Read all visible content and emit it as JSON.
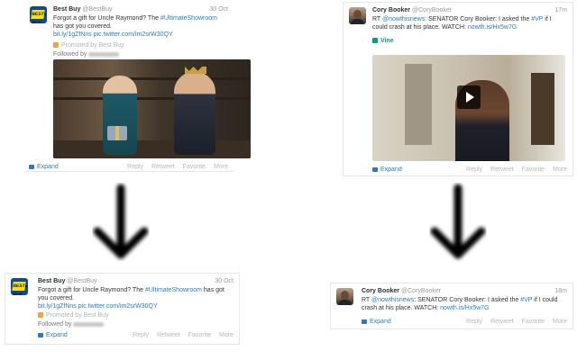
{
  "top_left": {
    "name": "Best Buy",
    "handle": "@BestBuy",
    "time": "30 Oct",
    "text_before": "Forgot a gift for Uncle Raymond? The ",
    "hashtag": "#UltimateShowroom",
    "text_after": " has got you covered.",
    "link": "bit.ly/1gZfNns pic.twitter.com/im2srW30QY",
    "promoted": "Promoted by Best Buy",
    "followed": "Followed by",
    "expand": "Expand",
    "reply": "Reply",
    "retweet": "Retweet",
    "favorite": "Favorite",
    "more": "More"
  },
  "top_right": {
    "name": "Cory Booker",
    "handle": "@CoryBooker",
    "time": "17m",
    "rt": "RT ",
    "mention": "@nowthisnews",
    "text_mid": ": SENATOR Cory Booker: I asked the ",
    "hashtag": "#VP",
    "text_after": " if I could crash at his place. WATCH: ",
    "link": "nowth.is/Hx5w7G",
    "vine": "Vine",
    "expand": "Expand",
    "reply": "Reply",
    "retweet": "Retweet",
    "favorite": "Favorite",
    "more": "More"
  },
  "bottom_left": {
    "name": "Best Buy",
    "handle": "@BestBuy",
    "time": "30 Oct",
    "text_before": "Forgot a gift for Uncle Raymond? The ",
    "hashtag": "#UltimateShowroom",
    "text_after": " has got you covered.",
    "link": "bit.ly/1gZfNns pic.twitter.com/im2srW30QY",
    "promoted": "Promoted by Best Buy",
    "followed": "Followed by",
    "expand": "Expand",
    "reply": "Reply",
    "retweet": "Retweet",
    "favorite": "Favorite",
    "more": "More"
  },
  "bottom_right": {
    "name": "Cory Booker",
    "handle": "@CoryBooker",
    "time": "18m",
    "rt": "RT ",
    "mention": "@nowthisnews",
    "text_mid": ": SENATOR Cory Booker: I asked the ",
    "hashtag": "#VP",
    "text_after": " if I could crash at his place. WATCH: ",
    "link": "nowth.is/Hx5w7G",
    "expand": "Expand",
    "reply": "Reply",
    "retweet": "Retweet",
    "favorite": "Favorite",
    "more": "More"
  },
  "logo_text": "BEST BUY",
  "icons": [
    "best-buy-logo-icon",
    "avatar-photo-icon",
    "promoted-icon",
    "vine-icon",
    "expand-icon",
    "play-icon",
    "down-arrow-icon"
  ],
  "colors": {
    "link": "#2b7bb9",
    "promoted": "#f2a33a",
    "vine": "#00a478",
    "brand_blue": "#0a4aa0",
    "brand_yellow": "#fce000"
  }
}
